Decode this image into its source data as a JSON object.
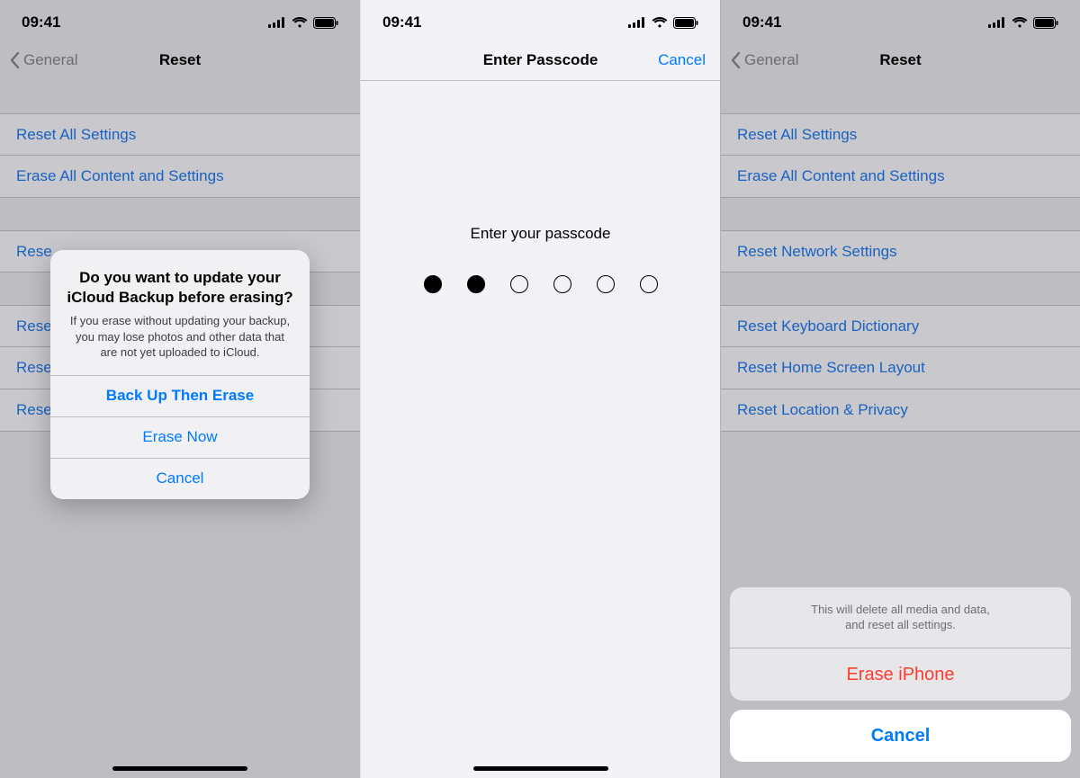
{
  "status": {
    "time": "09:41"
  },
  "screen1": {
    "nav": {
      "back": "General",
      "title": "Reset"
    },
    "items": [
      "Reset All Settings",
      "Erase All Content and Settings",
      "Rese",
      "Rese",
      "Rese",
      "Rese"
    ],
    "alert": {
      "title": "Do you want to update your iCloud Backup before erasing?",
      "message": "If you erase without updating your backup, you may lose photos and other data that are not yet uploaded to iCloud.",
      "buttons": {
        "primary": "Back Up Then Erase",
        "secondary": "Erase Now",
        "cancel": "Cancel"
      }
    }
  },
  "screen2": {
    "nav": {
      "title": "Enter Passcode",
      "cancel": "Cancel"
    },
    "prompt": "Enter your passcode",
    "dots": {
      "total": 6,
      "filled": 2
    }
  },
  "screen3": {
    "nav": {
      "back": "General",
      "title": "Reset"
    },
    "items": [
      "Reset All Settings",
      "Erase All Content and Settings",
      "Reset Network Settings",
      "Reset Keyboard Dictionary",
      "Reset Home Screen Layout",
      "Reset Location & Privacy"
    ],
    "sheet": {
      "message": "This will delete all media and data,\nand reset all settings.",
      "destructive": "Erase iPhone",
      "cancel": "Cancel"
    }
  }
}
